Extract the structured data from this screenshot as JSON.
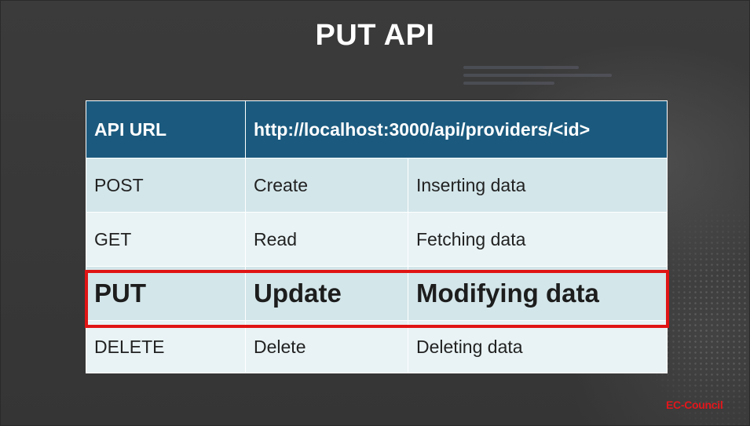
{
  "slide": {
    "title": "PUT API",
    "brand": "EC-Council"
  },
  "table": {
    "header": {
      "label": "API URL",
      "url": "http://localhost:3000/api/providers/<id>"
    },
    "rows": [
      {
        "method": "POST",
        "operation": "Create",
        "description": "Inserting data"
      },
      {
        "method": "GET",
        "operation": "Read",
        "description": "Fetching data"
      },
      {
        "method": "PUT",
        "operation": "Update",
        "description": "Modifying data"
      },
      {
        "method": "DELETE",
        "operation": "Delete",
        "description": "Deleting data"
      }
    ],
    "highlighted_row": "PUT",
    "colors": {
      "header": "#1b5a7e",
      "row_light": "#d3e6ea",
      "row_pale": "#e9f3f5",
      "highlight": "#e01414"
    }
  }
}
